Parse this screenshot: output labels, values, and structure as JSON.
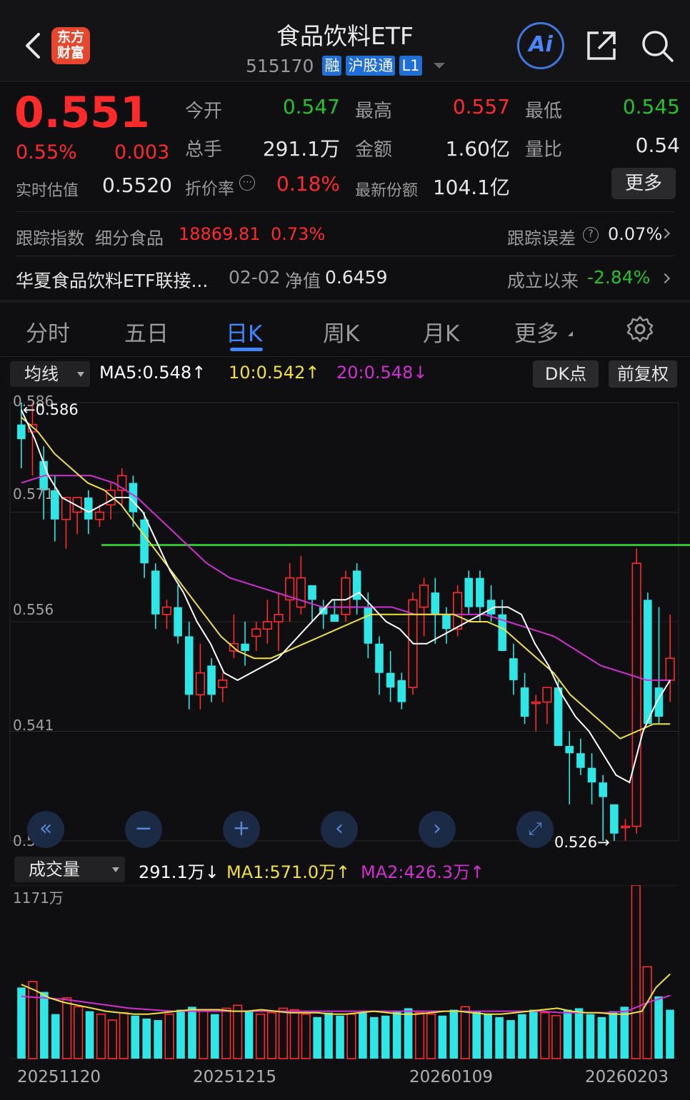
{
  "header": {
    "title": "食品饮料ETF",
    "code": "515170",
    "tags": [
      "融",
      "沪股通",
      "L1"
    ],
    "logo_text_line1": "东方",
    "logo_text_line2": "财富",
    "ai_label": "Ai"
  },
  "quote": {
    "price": "0.551",
    "change_pct": "0.55%",
    "change_abs": "0.003",
    "estimate_label": "实时估值",
    "estimate_value": "0.5520",
    "open_label": "今开",
    "open_value": "0.547",
    "high_label": "最高",
    "high_value": "0.557",
    "low_label": "最低",
    "low_value": "0.545",
    "volume_label": "总手",
    "volume_value": "291.1万",
    "amount_label": "金额",
    "amount_value": "1.60亿",
    "ratio_label": "量比",
    "ratio_value": "0.54",
    "discount_label": "折价率",
    "discount_value": "0.18%",
    "shares_label": "最新份额",
    "shares_value": "104.1亿",
    "more_label": "更多"
  },
  "tracking": {
    "index_label": "跟踪指数",
    "index_name": "细分食品",
    "index_value": "18869.81",
    "index_pct": "0.73%",
    "error_label": "跟踪误差",
    "error_value": "0.07%"
  },
  "linked": {
    "name": "华夏食品饮料ETF联接...",
    "nav_date": "02-02",
    "nav_label": "净值",
    "nav_value": "0.6459",
    "since_label": "成立以来",
    "since_value": "-2.84%"
  },
  "tabs": [
    "分时",
    "五日",
    "日K",
    "周K",
    "月K",
    "更多"
  ],
  "active_tab": "日K",
  "ma_bar": {
    "dropdown": "均线",
    "ma5": "MA5:0.548↑",
    "ma10": "10:0.542↑",
    "ma20": "20:0.548↓",
    "dk_label": "DK点",
    "adjust_label": "前复权"
  },
  "volume_bar": {
    "dropdown": "成交量",
    "vol": "291.1万↓",
    "ma1": "MA1:571.0万↑",
    "ma2": "MA2:426.3万↑",
    "max_label": "1171万"
  },
  "colors": {
    "up": "#ff2a2a",
    "down": "#23c12b",
    "candle_down": "#2ee6e6",
    "ma5": "#ffffff",
    "ma10": "#f0e040",
    "ma20": "#d030d0",
    "accent": "#3f86ff",
    "support_line": "#30c030"
  },
  "chart_data": {
    "type": "candlestick",
    "y_ticks": [
      "0.586",
      "0.571",
      "0.556",
      "0.541",
      "0.526"
    ],
    "ylim": [
      0.526,
      0.586
    ],
    "max_marker": "0.586",
    "min_marker": "0.526",
    "horizontal_line_value": 0.5665,
    "x_labels": [
      "20251120",
      "20251215",
      "20260109",
      "20260203"
    ],
    "candles": [
      [
        0.583,
        0.586,
        0.577,
        0.581
      ],
      [
        0.582,
        0.586,
        0.576,
        0.583
      ],
      [
        0.578,
        0.58,
        0.57,
        0.574
      ],
      [
        0.574,
        0.576,
        0.567,
        0.57
      ],
      [
        0.57,
        0.573,
        0.566,
        0.573
      ],
      [
        0.571,
        0.573,
        0.568,
        0.573
      ],
      [
        0.573,
        0.574,
        0.568,
        0.57
      ],
      [
        0.57,
        0.572,
        0.569,
        0.571
      ],
      [
        0.572,
        0.575,
        0.57,
        0.574
      ],
      [
        0.574,
        0.577,
        0.572,
        0.576
      ],
      [
        0.575,
        0.576,
        0.569,
        0.571
      ],
      [
        0.57,
        0.571,
        0.562,
        0.564
      ],
      [
        0.563,
        0.564,
        0.555,
        0.557
      ],
      [
        0.557,
        0.559,
        0.555,
        0.558
      ],
      [
        0.558,
        0.561,
        0.553,
        0.554
      ],
      [
        0.554,
        0.556,
        0.544,
        0.546
      ],
      [
        0.546,
        0.553,
        0.544,
        0.549
      ],
      [
        0.55,
        0.551,
        0.545,
        0.546
      ],
      [
        0.547,
        0.549,
        0.545,
        0.548
      ],
      [
        0.552,
        0.557,
        0.551,
        0.553
      ],
      [
        0.553,
        0.556,
        0.55,
        0.552
      ],
      [
        0.554,
        0.556,
        0.552,
        0.555
      ],
      [
        0.555,
        0.559,
        0.553,
        0.556
      ],
      [
        0.556,
        0.56,
        0.552,
        0.557
      ],
      [
        0.559,
        0.564,
        0.556,
        0.562
      ],
      [
        0.558,
        0.565,
        0.557,
        0.562
      ],
      [
        0.561,
        0.561,
        0.556,
        0.559
      ],
      [
        0.558,
        0.559,
        0.555,
        0.557
      ],
      [
        0.557,
        0.559,
        0.556,
        0.556
      ],
      [
        0.557,
        0.563,
        0.556,
        0.562
      ],
      [
        0.563,
        0.564,
        0.557,
        0.559
      ],
      [
        0.558,
        0.56,
        0.551,
        0.553
      ],
      [
        0.553,
        0.554,
        0.546,
        0.549
      ],
      [
        0.549,
        0.552,
        0.545,
        0.547
      ],
      [
        0.548,
        0.549,
        0.544,
        0.545
      ],
      [
        0.547,
        0.56,
        0.546,
        0.559
      ],
      [
        0.558,
        0.562,
        0.554,
        0.561
      ],
      [
        0.56,
        0.562,
        0.553,
        0.557
      ],
      [
        0.557,
        0.558,
        0.553,
        0.555
      ],
      [
        0.555,
        0.561,
        0.554,
        0.56
      ],
      [
        0.562,
        0.563,
        0.557,
        0.558
      ],
      [
        0.562,
        0.563,
        0.556,
        0.558
      ],
      [
        0.559,
        0.561,
        0.556,
        0.557
      ],
      [
        0.557,
        0.559,
        0.552,
        0.552
      ],
      [
        0.551,
        0.553,
        0.546,
        0.548
      ],
      [
        0.547,
        0.549,
        0.542,
        0.543
      ],
      [
        0.545,
        0.546,
        0.541,
        0.545
      ],
      [
        0.545,
        0.546,
        0.542,
        0.547
      ],
      [
        0.547,
        0.548,
        0.541,
        0.539
      ],
      [
        0.539,
        0.541,
        0.531,
        0.538
      ],
      [
        0.538,
        0.54,
        0.535,
        0.536
      ],
      [
        0.536,
        0.538,
        0.531,
        0.534
      ],
      [
        0.534,
        0.535,
        0.526,
        0.532
      ],
      [
        0.531,
        0.531,
        0.526,
        0.527
      ],
      [
        0.528,
        0.529,
        0.526,
        0.528
      ],
      [
        0.528,
        0.566,
        0.527,
        0.564
      ],
      [
        0.559,
        0.56,
        0.545,
        0.542
      ],
      [
        0.547,
        0.558,
        0.542,
        0.543
      ],
      [
        0.548,
        0.557,
        0.545,
        0.551
      ]
    ],
    "ma5": [
      0.585,
      0.581,
      0.576,
      0.573,
      0.572,
      0.571,
      0.572,
      0.573,
      0.573,
      0.571,
      0.567,
      0.563,
      0.56,
      0.556,
      0.553,
      0.549,
      0.548,
      0.549,
      0.55,
      0.551,
      0.553,
      0.555,
      0.557,
      0.559,
      0.559,
      0.56,
      0.558,
      0.556,
      0.555,
      0.553,
      0.553,
      0.554,
      0.555,
      0.556,
      0.557,
      0.558,
      0.558,
      0.557,
      0.553,
      0.55,
      0.546,
      0.543,
      0.541,
      0.538,
      0.535,
      0.534,
      0.541,
      0.545,
      0.548
    ],
    "ma10": [
      0.584,
      0.582,
      0.579,
      0.577,
      0.575,
      0.574,
      0.572,
      0.569,
      0.566,
      0.563,
      0.56,
      0.557,
      0.554,
      0.552,
      0.551,
      0.551,
      0.552,
      0.553,
      0.554,
      0.555,
      0.556,
      0.557,
      0.557,
      0.557,
      0.557,
      0.557,
      0.557,
      0.556,
      0.556,
      0.555,
      0.553,
      0.551,
      0.549,
      0.546,
      0.544,
      0.542,
      0.54,
      0.541,
      0.542,
      0.542
    ],
    "ma20": [
      0.575,
      0.576,
      0.576,
      0.576,
      0.575,
      0.573,
      0.57,
      0.567,
      0.564,
      0.562,
      0.561,
      0.56,
      0.559,
      0.558,
      0.558,
      0.558,
      0.558,
      0.557,
      0.557,
      0.557,
      0.557,
      0.556,
      0.555,
      0.554,
      0.552,
      0.55,
      0.549,
      0.548,
      0.548
    ],
    "volumes": [
      480,
      520,
      450,
      300,
      410,
      350,
      320,
      300,
      260,
      310,
      290,
      270,
      260,
      300,
      330,
      350,
      330,
      300,
      340,
      360,
      320,
      300,
      310,
      340,
      330,
      300,
      280,
      310,
      290,
      300,
      310,
      280,
      290,
      320,
      340,
      310,
      300,
      290,
      330,
      350,
      320,
      300,
      280,
      260,
      300,
      330,
      310,
      290,
      330,
      340,
      300,
      280,
      320,
      350,
      1171,
      620,
      420,
      330
    ],
    "vol_ma1": [
      500,
      460,
      410,
      380,
      360,
      340,
      320,
      310,
      300,
      300,
      310,
      320,
      330,
      330,
      330,
      320,
      320,
      330,
      320,
      310,
      310,
      310,
      300,
      300,
      310,
      320,
      310,
      300,
      300,
      310,
      320,
      320,
      310,
      300,
      300,
      310,
      320,
      330,
      340,
      320,
      310,
      310,
      300,
      300,
      320,
      480,
      571
    ],
    "vol_ma2": [
      420,
      410,
      400,
      380,
      360,
      340,
      330,
      320,
      320,
      320,
      320,
      320,
      320,
      320,
      320,
      320,
      320,
      320,
      320,
      320,
      320,
      320,
      320,
      320,
      320,
      310,
      310,
      310,
      320,
      380,
      426
    ]
  }
}
